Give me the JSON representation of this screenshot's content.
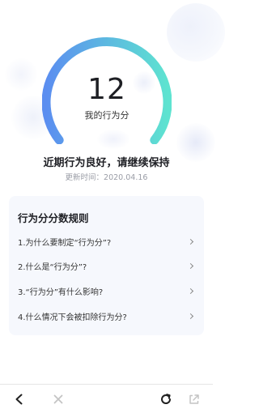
{
  "colors": {
    "gauge_start": "#5b8ef0",
    "gauge_end": "#5ee3d0",
    "text_dark": "#1e1f24",
    "text_muted": "#9a9da6",
    "card_bg": "#f6f8fd"
  },
  "score": {
    "value": "12",
    "label": "我的行为分"
  },
  "status": {
    "headline": "近期行为良好，请继续保持",
    "updated_prefix": "更新时间：",
    "updated_date": "2020.04.16"
  },
  "rules": {
    "title": "行为分分数规则",
    "items": [
      {
        "label": "1.为什么要制定“行为分”?"
      },
      {
        "label": "2.什么是“行为分”?"
      },
      {
        "label": "3.“行为分”有什么影响?"
      },
      {
        "label": "4.什么情况下会被扣除行为分?"
      }
    ]
  },
  "toolbar": {
    "back_icon": "chevron-left-icon",
    "close_icon": "close-icon",
    "refresh_icon": "refresh-icon",
    "share_icon": "share-icon"
  }
}
